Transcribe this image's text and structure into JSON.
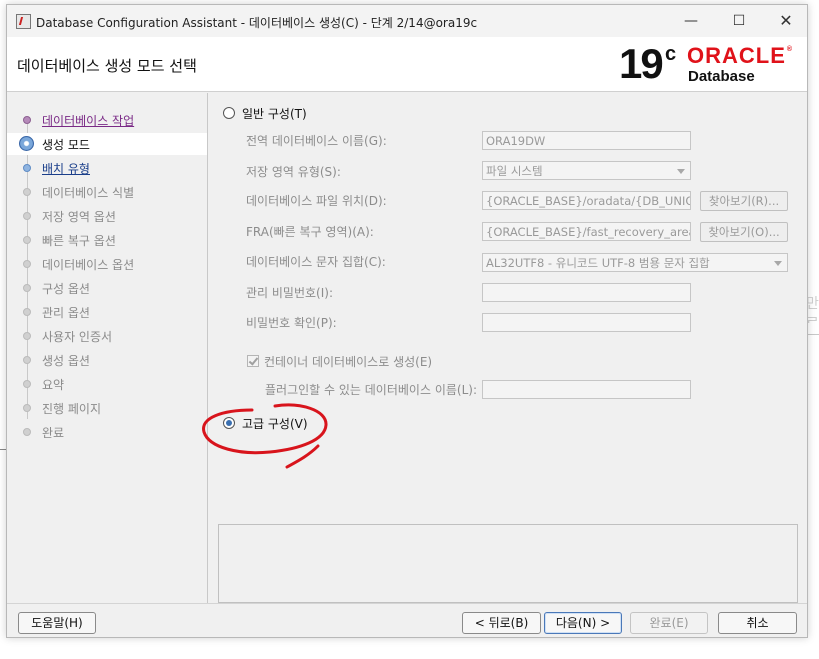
{
  "window": {
    "title": "Database Configuration Assistant - 데이터베이스 생성(C) - 단계 2/14@ora19c",
    "controls": {
      "minimize": "—",
      "maximize": "☐",
      "close": "✕"
    }
  },
  "header": {
    "page_title": "데이터베이스 생성 모드 선택",
    "logo": {
      "version": "19",
      "version_suffix": "c",
      "brand": "ORACLE",
      "product": "Database",
      "brand_color": "#e0121a"
    }
  },
  "nav": {
    "items": [
      {
        "label": "데이터베이스 작업",
        "state": "done"
      },
      {
        "label": "생성 모드",
        "state": "current"
      },
      {
        "label": "배치 유형",
        "state": "next"
      },
      {
        "label": "데이터베이스 식별",
        "state": "pending"
      },
      {
        "label": "저장 영역 옵션",
        "state": "pending"
      },
      {
        "label": "빠른 복구 옵션",
        "state": "pending"
      },
      {
        "label": "데이터베이스 옵션",
        "state": "pending"
      },
      {
        "label": "구성 옵션",
        "state": "pending"
      },
      {
        "label": "관리 옵션",
        "state": "pending"
      },
      {
        "label": "사용자 인증서",
        "state": "pending"
      },
      {
        "label": "생성 옵션",
        "state": "pending"
      },
      {
        "label": "요약",
        "state": "pending"
      },
      {
        "label": "진행 페이지",
        "state": "pending"
      },
      {
        "label": "완료",
        "state": "pending"
      }
    ]
  },
  "content": {
    "typical_option": {
      "label": "일반 구성(T)",
      "selected": false
    },
    "fields": {
      "global_db_name": {
        "label": "전역 데이터베이스 이름(G):",
        "value": "ORA19DW"
      },
      "storage_type": {
        "label": "저장 영역 유형(S):",
        "value": "파일 시스템"
      },
      "db_file_location": {
        "label": "데이터베이스 파일 위치(D):",
        "value": "{ORACLE_BASE}/oradata/{DB_UNIQU",
        "browse": "찾아보기(R)..."
      },
      "fra": {
        "label": "FRA(빠른 복구 영역)(A):",
        "value": "{ORACLE_BASE}/fast_recovery_area/",
        "browse": "찾아보기(O)..."
      },
      "charset": {
        "label": "데이터베이스 문자 집합(C):",
        "value": "AL32UTF8 - 유니코드 UTF-8 범용 문자 집합"
      },
      "admin_password": {
        "label": "관리 비밀번호(I):",
        "value": ""
      },
      "confirm_password": {
        "label": "비밀번호 확인(P):",
        "value": ""
      },
      "container_db": {
        "label": "컨테이너 데이터베이스로 생성(E)",
        "checked": true
      },
      "pluggable_db_name": {
        "label": "플러그인할 수 있는 데이터베이스 이름(L):",
        "value": ""
      }
    },
    "advanced_option": {
      "label": "고급 구성(V)",
      "selected": true
    },
    "annotation_color": "#d8141c"
  },
  "footer": {
    "help": "도움말(H)",
    "back": "< 뒤로(B)",
    "next": "다음(N) >",
    "finish": "완료(E)",
    "cancel": "취소"
  },
  "background": {
    "right_edge_text": "만료"
  }
}
